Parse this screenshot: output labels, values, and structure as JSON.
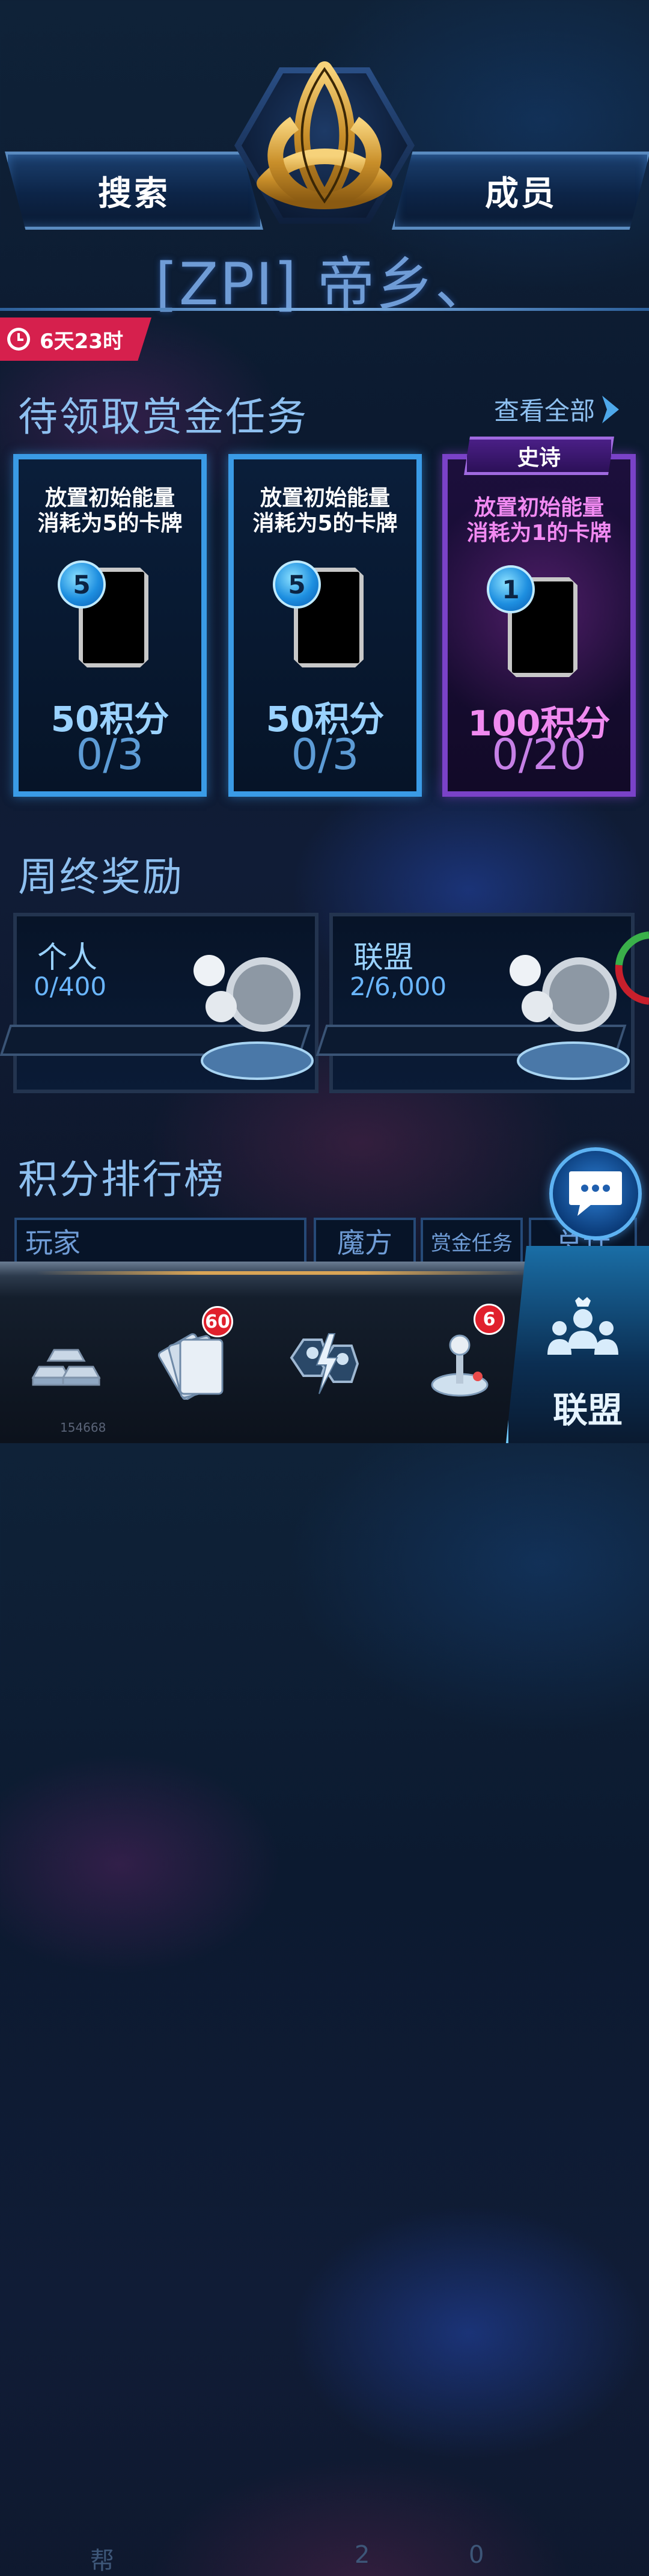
{
  "header": {
    "search_label": "搜索",
    "members_label": "成员",
    "alliance_title": "[ZPI] 帝乡、"
  },
  "timer": {
    "text": "6天23时"
  },
  "bounty": {
    "section_title": "待领取赏金任务",
    "view_all": "查看全部",
    "cards": [
      {
        "desc_line1": "放置初始能量",
        "desc_line2": "消耗为5的卡牌",
        "energy": "5",
        "points": "50积分",
        "progress": "0/3"
      },
      {
        "desc_line1": "放置初始能量",
        "desc_line2": "消耗为5的卡牌",
        "energy": "5",
        "points": "50积分",
        "progress": "0/3"
      },
      {
        "tag": "史诗",
        "desc_line1": "放置初始能量",
        "desc_line2": "消耗为1的卡牌",
        "energy": "1",
        "points": "100积分",
        "progress": "0/20"
      }
    ]
  },
  "weekly": {
    "section_title": "周终奖励",
    "personal": {
      "label": "个人",
      "value": "0/400"
    },
    "alliance": {
      "label": "联盟",
      "value": "2/6,000"
    }
  },
  "leaderboard": {
    "section_title": "积分排行榜",
    "columns": [
      "玩家",
      "魔方",
      "赏金任务",
      "总计"
    ],
    "row_partial": [
      "帮",
      "2",
      "0"
    ]
  },
  "nav": {
    "cards_badge": "60",
    "play_badge": "6",
    "active_label": "联盟"
  },
  "footer": {
    "id": "154668"
  },
  "colors": {
    "accent": "#3a9be6",
    "epic": "#7a42c8",
    "timer": "#d6204d",
    "title": "#6f9cd6"
  }
}
